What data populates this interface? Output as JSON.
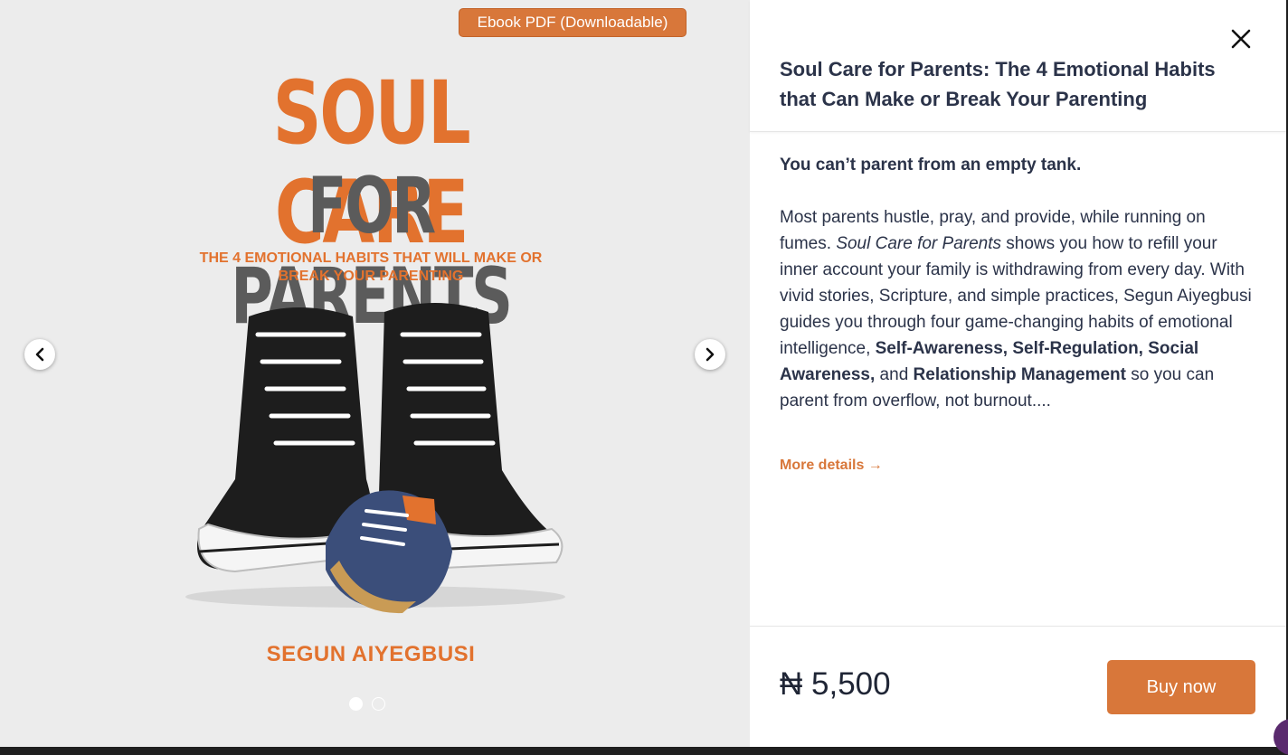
{
  "gallery": {
    "format_badge": "Ebook PDF (Downloadable)",
    "cover": {
      "title_line1": "SOUL CARE",
      "title_line2": "FOR PARENTS",
      "subtitle": "THE 4 EMOTIONAL HABITS THAT WILL MAKE OR BREAK YOUR PARENTING",
      "author": "SEGUN AIYEGBUSI"
    },
    "slide_count": 2,
    "active_slide": 1,
    "prev_icon": "chevron-left-icon",
    "next_icon": "chevron-right-icon"
  },
  "product": {
    "title": "Soul Care for Parents: The 4 Emotional Habits that Can Make or Break Your Parenting",
    "description": {
      "lead": "You can’t parent from an empty tank.",
      "p1": "Most parents hustle, pray, and provide, while running on fumes. ",
      "book_title": "Soul Care for Parents",
      "p2": " shows you how to refill your inner account your family is withdrawing from every day. With vivid stories, Scripture, and simple practices, Segun Aiyegbusi guides you through four game-changing habits of emotional intelligence, ",
      "habits": "Self-Awareness, Self-Regulation, Social Awareness,",
      "p3": " and ",
      "habit_last": "Relationship Management",
      "p4": " so you can parent from overflow, not burnout...."
    },
    "more_details": "More details →",
    "price": "₦ 5,500",
    "buy_label": "Buy now",
    "close_icon": "close-icon"
  },
  "colors": {
    "accent": "#d8773a",
    "title_text": "#2b3349",
    "cover_grey": "#5b5b5b",
    "gallery_bg": "#ececec"
  }
}
